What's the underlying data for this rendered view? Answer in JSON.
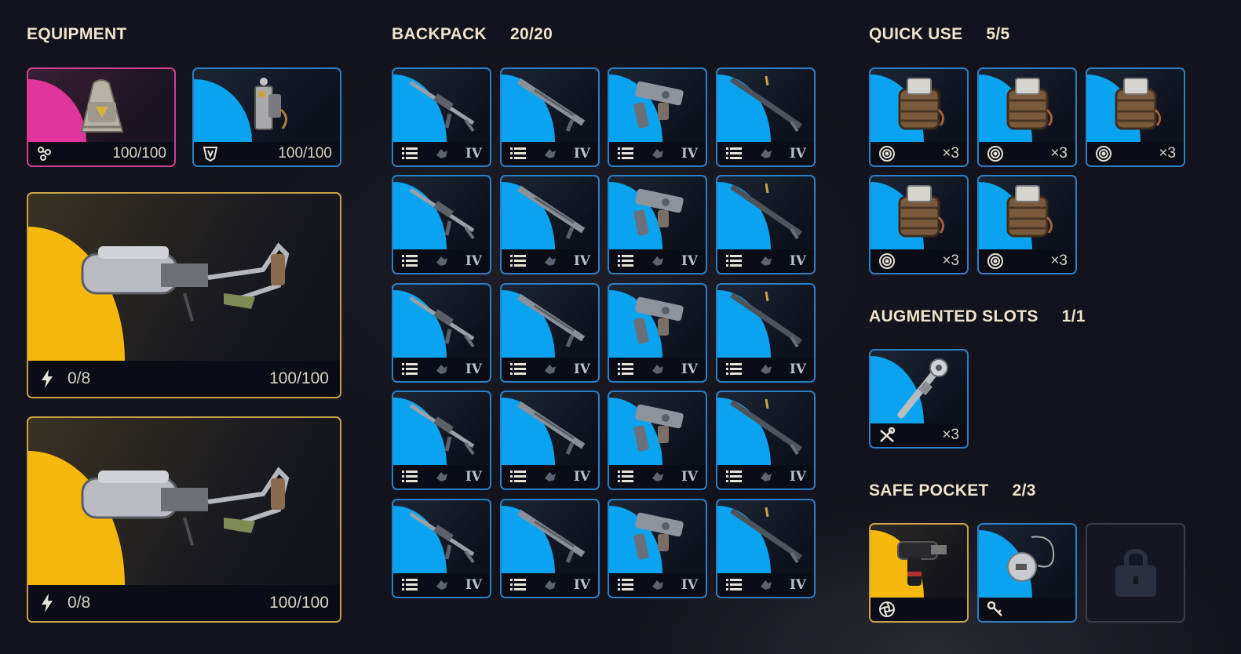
{
  "sections": {
    "equipment": {
      "title": "EQUIPMENT"
    },
    "backpack": {
      "title": "BACKPACK",
      "count": "20/20"
    },
    "quick_use": {
      "title": "QUICK USE",
      "count": "5/5"
    },
    "augmented": {
      "title": "AUGMENTED SLOTS",
      "count": "1/1"
    },
    "safe_pocket": {
      "title": "SAFE POCKET",
      "count": "2/3"
    }
  },
  "equipment": {
    "augment": {
      "value": "100/100",
      "icon": "augment-icon"
    },
    "shield": {
      "value": "100/100",
      "icon": "shield-icon"
    },
    "weapons": [
      {
        "ammo": "0/8",
        "durability": "100/100",
        "icon": "lightning-icon"
      },
      {
        "ammo": "0/8",
        "durability": "100/100",
        "icon": "lightning-icon"
      }
    ]
  },
  "backpack_items": [
    {
      "kind": "rifle",
      "tier": "IV"
    },
    {
      "kind": "smg",
      "tier": "IV"
    },
    {
      "kind": "pistol",
      "tier": "IV"
    },
    {
      "kind": "sniper",
      "tier": "IV"
    },
    {
      "kind": "rifle",
      "tier": "IV"
    },
    {
      "kind": "smg",
      "tier": "IV"
    },
    {
      "kind": "pistol",
      "tier": "IV"
    },
    {
      "kind": "sniper",
      "tier": "IV"
    },
    {
      "kind": "rifle",
      "tier": "IV"
    },
    {
      "kind": "smg",
      "tier": "IV"
    },
    {
      "kind": "pistol",
      "tier": "IV"
    },
    {
      "kind": "sniper",
      "tier": "IV"
    },
    {
      "kind": "rifle",
      "tier": "IV"
    },
    {
      "kind": "smg",
      "tier": "IV"
    },
    {
      "kind": "pistol",
      "tier": "IV"
    },
    {
      "kind": "sniper",
      "tier": "IV"
    },
    {
      "kind": "rifle",
      "tier": "IV"
    },
    {
      "kind": "smg",
      "tier": "IV"
    },
    {
      "kind": "pistol",
      "tier": "IV"
    },
    {
      "kind": "sniper",
      "tier": "IV"
    }
  ],
  "quick_use_items": [
    {
      "qty": "×3",
      "icon": "target-icon"
    },
    {
      "qty": "×3",
      "icon": "target-icon"
    },
    {
      "qty": "×3",
      "icon": "target-icon"
    },
    {
      "qty": "×3",
      "icon": "target-icon"
    },
    {
      "qty": "×3",
      "icon": "target-icon"
    }
  ],
  "augmented_items": [
    {
      "qty": "×3",
      "icon": "tools-icon"
    }
  ],
  "safe_pocket_items": [
    {
      "icon": "aperture-icon",
      "rarity": "gold"
    },
    {
      "icon": "key-icon",
      "rarity": "blue"
    },
    {
      "icon": "lock-icon",
      "rarity": "locked"
    }
  ],
  "colors": {
    "blue_rarity": "#0aa3f0",
    "gold_rarity": "#f6b80b",
    "pink_rarity": "#e0369c",
    "text": "#efe3cd"
  }
}
